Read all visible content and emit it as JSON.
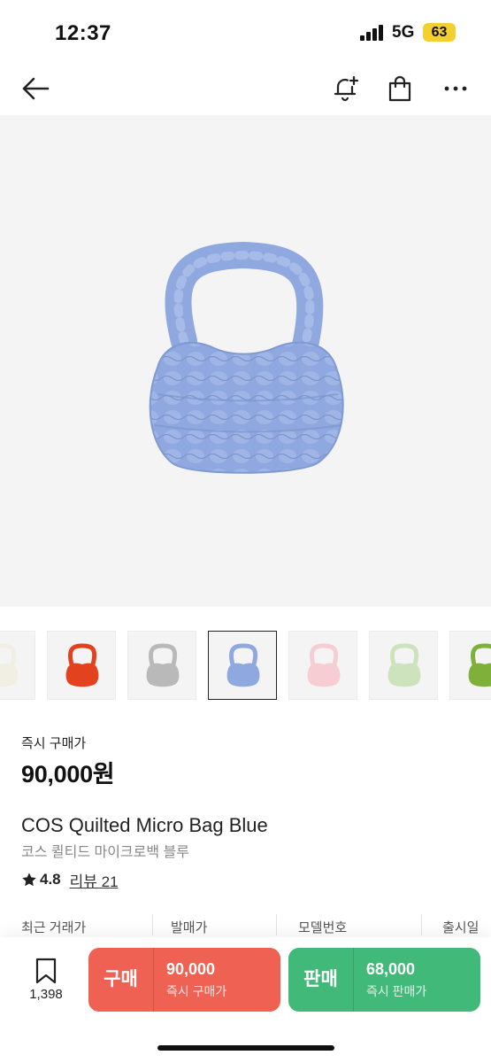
{
  "status_bar": {
    "time": "12:37",
    "network": "5G",
    "battery": "63"
  },
  "nav": {
    "back_icon": "arrow-left-icon",
    "alert_icon": "bell-plus-icon",
    "bag_icon": "shopping-bag-icon",
    "more_icon": "more-dots-icon"
  },
  "product": {
    "hero_color": "#8fa8df",
    "thumbnails": [
      {
        "color": "#f1efe4",
        "active": false
      },
      {
        "color": "#e3421f",
        "active": false
      },
      {
        "color": "#b9b9b9",
        "active": false
      },
      {
        "color": "#8fa8df",
        "active": true
      },
      {
        "color": "#f6cdd3",
        "active": false
      },
      {
        "color": "#cde3bd",
        "active": false
      },
      {
        "color": "#7fb13a",
        "active": false
      }
    ],
    "instant_buy_label": "즉시 구매가",
    "price": "90,000원",
    "name_en": "COS Quilted Micro Bag Blue",
    "name_ko": "코스 퀼티드 마이크로백 블루",
    "rating": "4.8",
    "reviews": "리뷰 21"
  },
  "info_columns": [
    "최근 거래가",
    "발매가",
    "모델번호",
    "출시일"
  ],
  "bottom_bar": {
    "wish_count": "1,398",
    "buy": {
      "label": "구매",
      "price": "90,000",
      "sub": "즉시 구매가",
      "color": "#ef6253"
    },
    "sell": {
      "label": "판매",
      "price": "68,000",
      "sub": "즉시 판매가",
      "color": "#41b979"
    }
  }
}
